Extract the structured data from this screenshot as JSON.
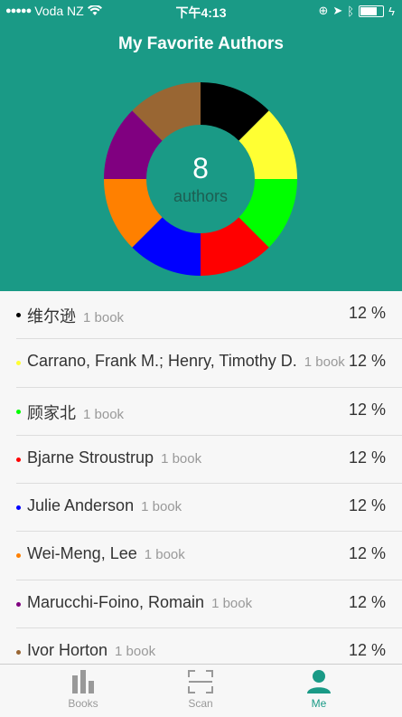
{
  "status_bar": {
    "carrier": "Voda NZ",
    "time": "下午4:13",
    "battery_level": 0.7
  },
  "header": {
    "title": "My Favorite Authors",
    "count": "8",
    "count_label": "authors"
  },
  "chart_data": {
    "type": "pie",
    "values": [
      12.5,
      12.5,
      12.5,
      12.5,
      12.5,
      12.5,
      12.5,
      12.5
    ],
    "colors": [
      "#000000",
      "#ffff33",
      "#00ff00",
      "#ff0000",
      "#0000ff",
      "#ff8000",
      "#800080",
      "#996633"
    ]
  },
  "authors": [
    {
      "name": "维尔逊",
      "count": "1 book",
      "pct": "12 %",
      "color": "#000000"
    },
    {
      "name": "Carrano, Frank M.; Henry, Timothy D.",
      "count": "1 book",
      "pct": "12 %",
      "color": "#ffff33"
    },
    {
      "name": "顾家北",
      "count": "1 book",
      "pct": "12 %",
      "color": "#00ff00"
    },
    {
      "name": "Bjarne Stroustrup",
      "count": "1 book",
      "pct": "12 %",
      "color": "#ff0000"
    },
    {
      "name": "Julie Anderson",
      "count": "1 book",
      "pct": "12 %",
      "color": "#0000ff"
    },
    {
      "name": "Wei-Meng, Lee",
      "count": "1 book",
      "pct": "12 %",
      "color": "#ff8000"
    },
    {
      "name": "Marucchi-Foino, Romain",
      "count": "1 book",
      "pct": "12 %",
      "color": "#800080"
    },
    {
      "name": "Ivor Horton",
      "count": "1 book",
      "pct": "12 %",
      "color": "#996633"
    }
  ],
  "tabs": [
    {
      "label": "Books",
      "icon": "bar-chart-icon"
    },
    {
      "label": "Scan",
      "icon": "scan-icon"
    },
    {
      "label": "Me",
      "icon": "person-icon"
    }
  ]
}
